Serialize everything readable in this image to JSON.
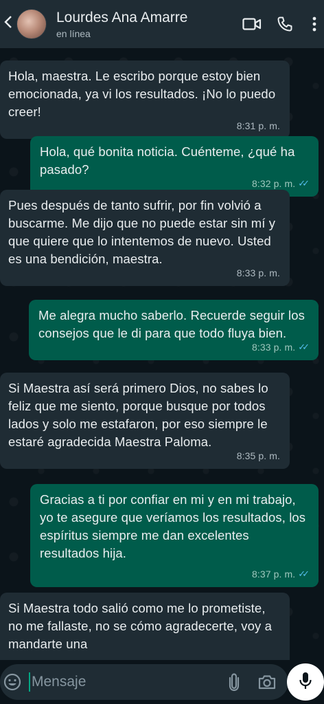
{
  "header": {
    "contact_name": "Lourdes Ana Amarre",
    "status": "en línea",
    "icons": [
      "video-call-icon",
      "phone-call-icon",
      "more-options-icon"
    ]
  },
  "messages": [
    {
      "direction": "incoming",
      "text": "Hola, maestra. Le escribo porque estoy bien emocionada, ya vi los resultados. ¡No lo puedo creer!",
      "time": "8:31 p. m."
    },
    {
      "direction": "outgoing",
      "text": "Hola, qué bonita noticia. Cuénteme, ¿qué ha pasado?",
      "time": "8:32 p. m.",
      "read": true
    },
    {
      "direction": "incoming",
      "text": "Pues después de tanto sufrir, por fin volvió a buscarme. Me dijo que no puede estar sin mí y que quiere que lo intentemos de nuevo. Usted es una bendición, maestra.",
      "time": "8:33 p. m."
    },
    {
      "direction": "outgoing",
      "text": "Me alegra mucho saberlo. Recuerde seguir los consejos que le di para que todo fluya bien.",
      "time": "8:33 p. m.",
      "read": true
    },
    {
      "direction": "incoming",
      "text": "Si Maestra así será primero Dios, no sabes lo feliz que me siento, porque busque por todos lados y solo me estafaron, por eso siempre le estaré agradecida Maestra Paloma.",
      "time": "8:35 p. m."
    },
    {
      "direction": "outgoing",
      "text": "Gracias a ti por confiar en mi y en mi trabajo, yo te asegure que veríamos los resultados,  los espíritus siempre me dan excelentes resultados hija.",
      "time": "8:37 p. m.",
      "read": true
    },
    {
      "direction": "incoming",
      "text": "Si Maestra todo salió como me lo prometiste, no me fallaste, no se cómo agradecerte, voy a mandarte una",
      "time": ""
    }
  ],
  "input": {
    "placeholder": "Mensaje",
    "value": ""
  },
  "colors": {
    "background": "#0b141a",
    "header": "#1f2c34",
    "incoming_bubble": "#1f2c34",
    "outgoing_bubble": "#005c4b",
    "read_ticks": "#53bdeb"
  }
}
